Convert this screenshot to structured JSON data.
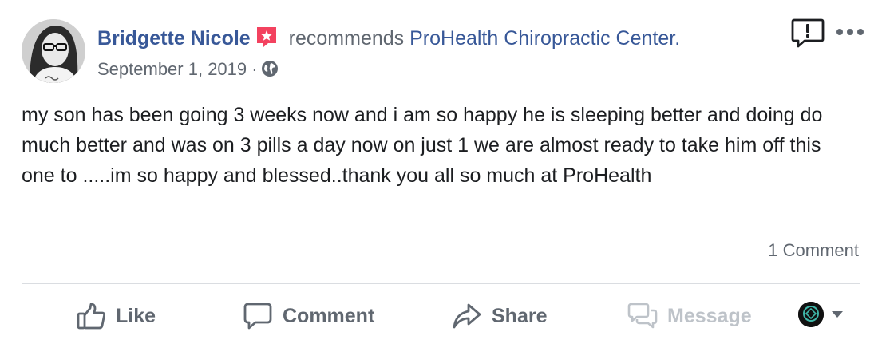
{
  "post": {
    "author": "Bridgette Nicole",
    "verb": "recommends",
    "page": "ProHealth Chiropractic Center.",
    "date": "September 1, 2019",
    "date_separator": "·",
    "body": "my son has been going 3 weeks now and i am so happy he is sleeping better and doing do much better and was on 3 pills a day now on just 1 we are almost ready to take him off this one to .....im so happy and blessed..thank you all so much at ProHealth",
    "comment_count": "1 Comment"
  },
  "actions": {
    "like": "Like",
    "comment": "Comment",
    "share": "Share",
    "message": "Message"
  },
  "icons": {
    "recommend": "recommendation-star-icon",
    "privacy": "globe-icon",
    "report": "report-exclamation-icon",
    "more": "more-dots-icon",
    "like": "thumbs-up-icon",
    "comment": "speech-bubble-icon",
    "share": "share-arrow-icon",
    "message": "messenger-bubbles-icon",
    "audience_caret": "caret-down-icon"
  },
  "colors": {
    "link_blue": "#385898",
    "secondary_text": "#606770",
    "body_text": "#1c1e21",
    "recommend_red": "#f3425f",
    "disabled": "#bec3c9",
    "divider": "#dadde1"
  }
}
